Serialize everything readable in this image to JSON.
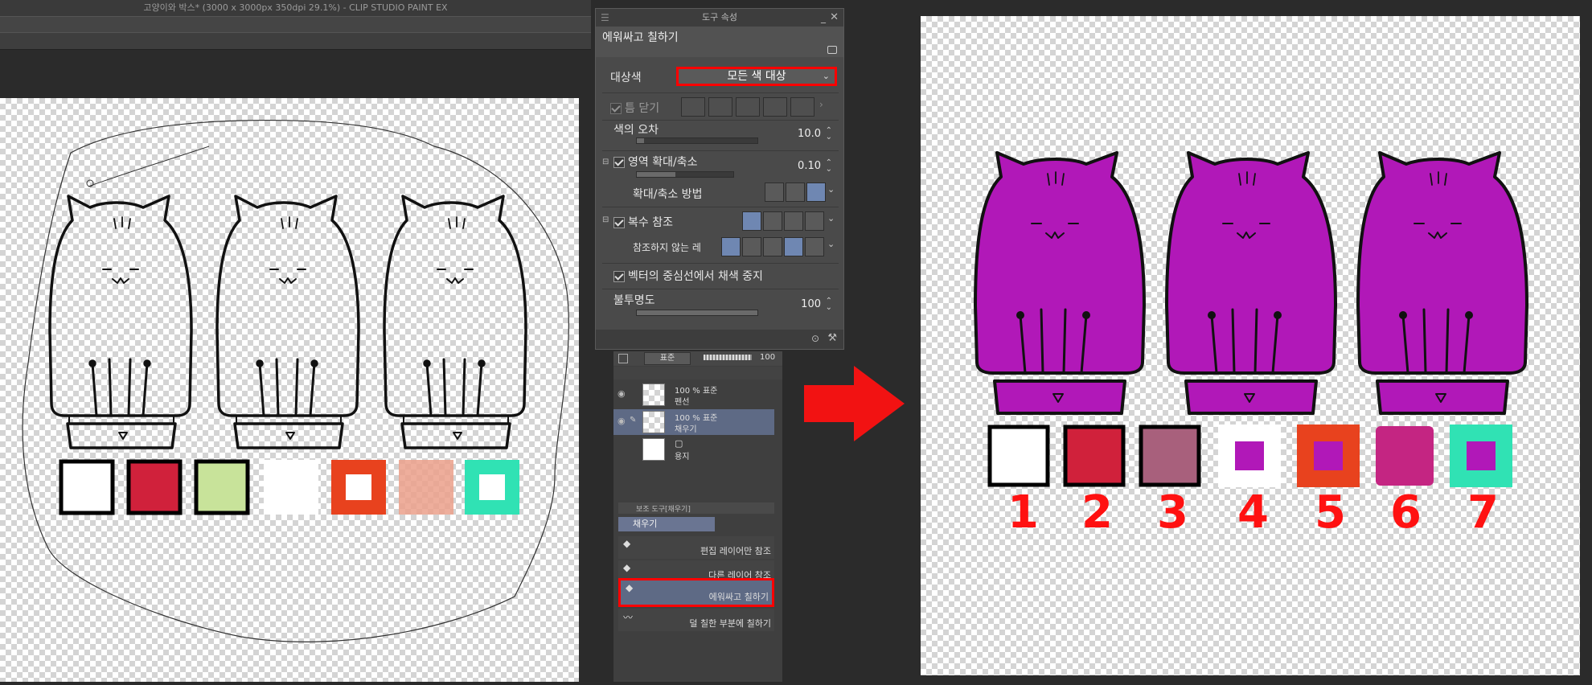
{
  "app": {
    "window_title": "고양이와 박스* (3000 x 3000px 350dpi 29.1%)  - CLIP STUDIO PAINT EX"
  },
  "tool_property": {
    "panel_title": "도구 속성",
    "subtool_name": "에워싸고 칠하기",
    "target_color_label": "대상색",
    "target_color_value": "모든 색 대상",
    "close_gap_label": "틈 닫기",
    "tolerance_label": "색의 오차",
    "tolerance_value": "10.0",
    "area_scaling_label": "영역 확대/축소",
    "area_scaling_value": "0.10",
    "scaling_method_label": "확대/축소 방법",
    "multi_ref_label": "복수 참조",
    "no_ref_layer_label": "참조하지 않는 레",
    "vector_stop_label": "벡터의 중심선에서 채색 중지",
    "opacity_label": "불투명도",
    "opacity_value": "100"
  },
  "layers": {
    "blend_mode": "표준",
    "opacity": "100",
    "items": [
      {
        "percent": "100 % 표준",
        "name": "펜선"
      },
      {
        "percent": "100 % 표준",
        "name": "채우기"
      },
      {
        "percent": "",
        "name": "용지"
      }
    ]
  },
  "subtools": {
    "header": "보조 도구[채우기]",
    "tab": "채우기",
    "items": [
      {
        "name": "편집 레이어만 참조"
      },
      {
        "name": "다른 레이어 참조"
      },
      {
        "name": "에워싸고 칠하기"
      },
      {
        "name": "덜 칠한 부분에 칠하기"
      }
    ]
  },
  "swatch_numbers": [
    "1",
    "2",
    "3",
    "4",
    "5",
    "6",
    "7"
  ],
  "colors": {
    "fill_purple": "#b118b8",
    "highlight_red": "#ff0000",
    "arrow_red": "#f21212",
    "swatch_red": "#d0213b",
    "swatch_green": "#c8e39a",
    "swatch_orange": "#e8421e",
    "swatch_salmon": "#eba08b",
    "swatch_teal": "#30e2b4",
    "swatch_mauve": "#a8607c",
    "swatch_magenta": "#c42582"
  }
}
